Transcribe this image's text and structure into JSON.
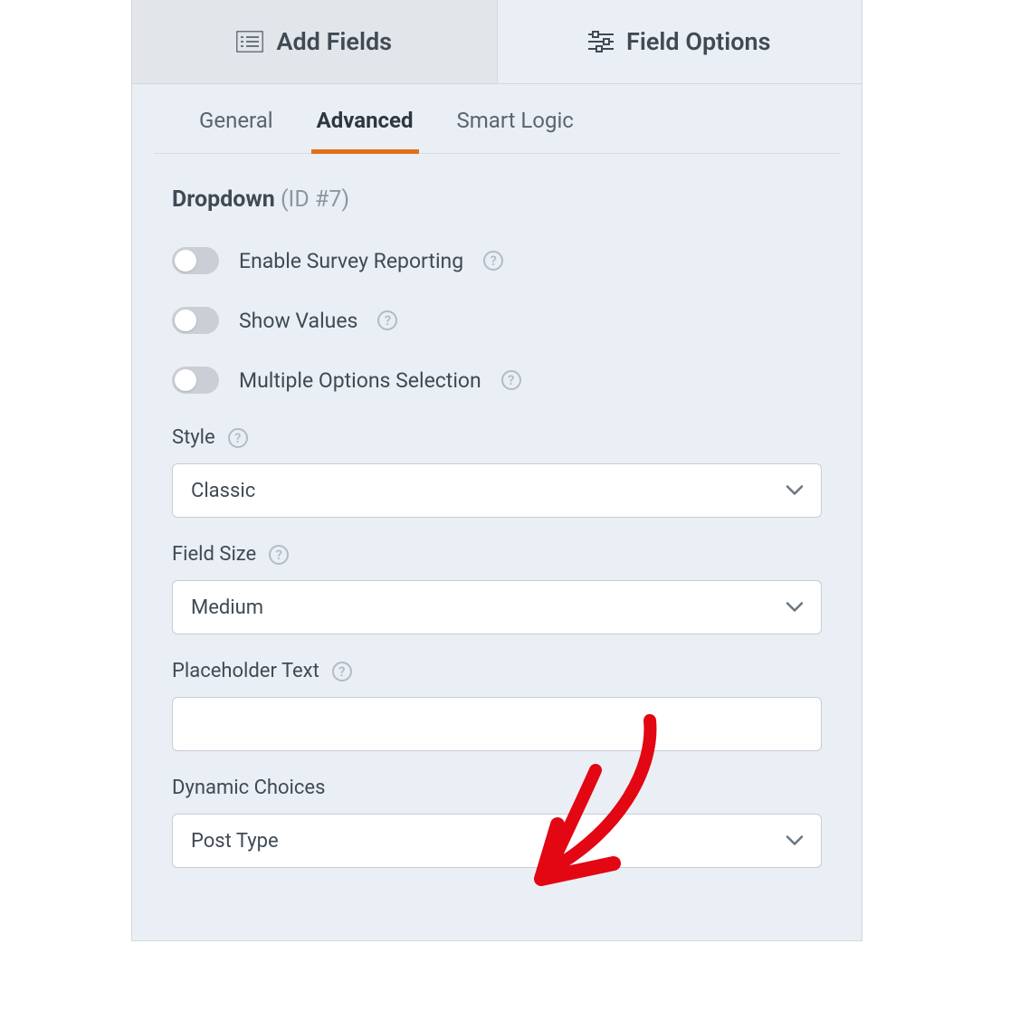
{
  "main_tabs": {
    "add_fields": "Add Fields",
    "field_options": "Field Options"
  },
  "sub_tabs": {
    "general": "General",
    "advanced": "Advanced",
    "smart_logic": "Smart Logic"
  },
  "field": {
    "type": "Dropdown",
    "id_label": "(ID #7)"
  },
  "toggles": {
    "survey": "Enable Survey Reporting",
    "show_values": "Show Values",
    "multiple": "Multiple Options Selection"
  },
  "style": {
    "label": "Style",
    "value": "Classic"
  },
  "field_size": {
    "label": "Field Size",
    "value": "Medium"
  },
  "placeholder": {
    "label": "Placeholder Text",
    "value": ""
  },
  "dynamic_choices": {
    "label": "Dynamic Choices",
    "value": "Post Type"
  },
  "help_glyph": "?"
}
